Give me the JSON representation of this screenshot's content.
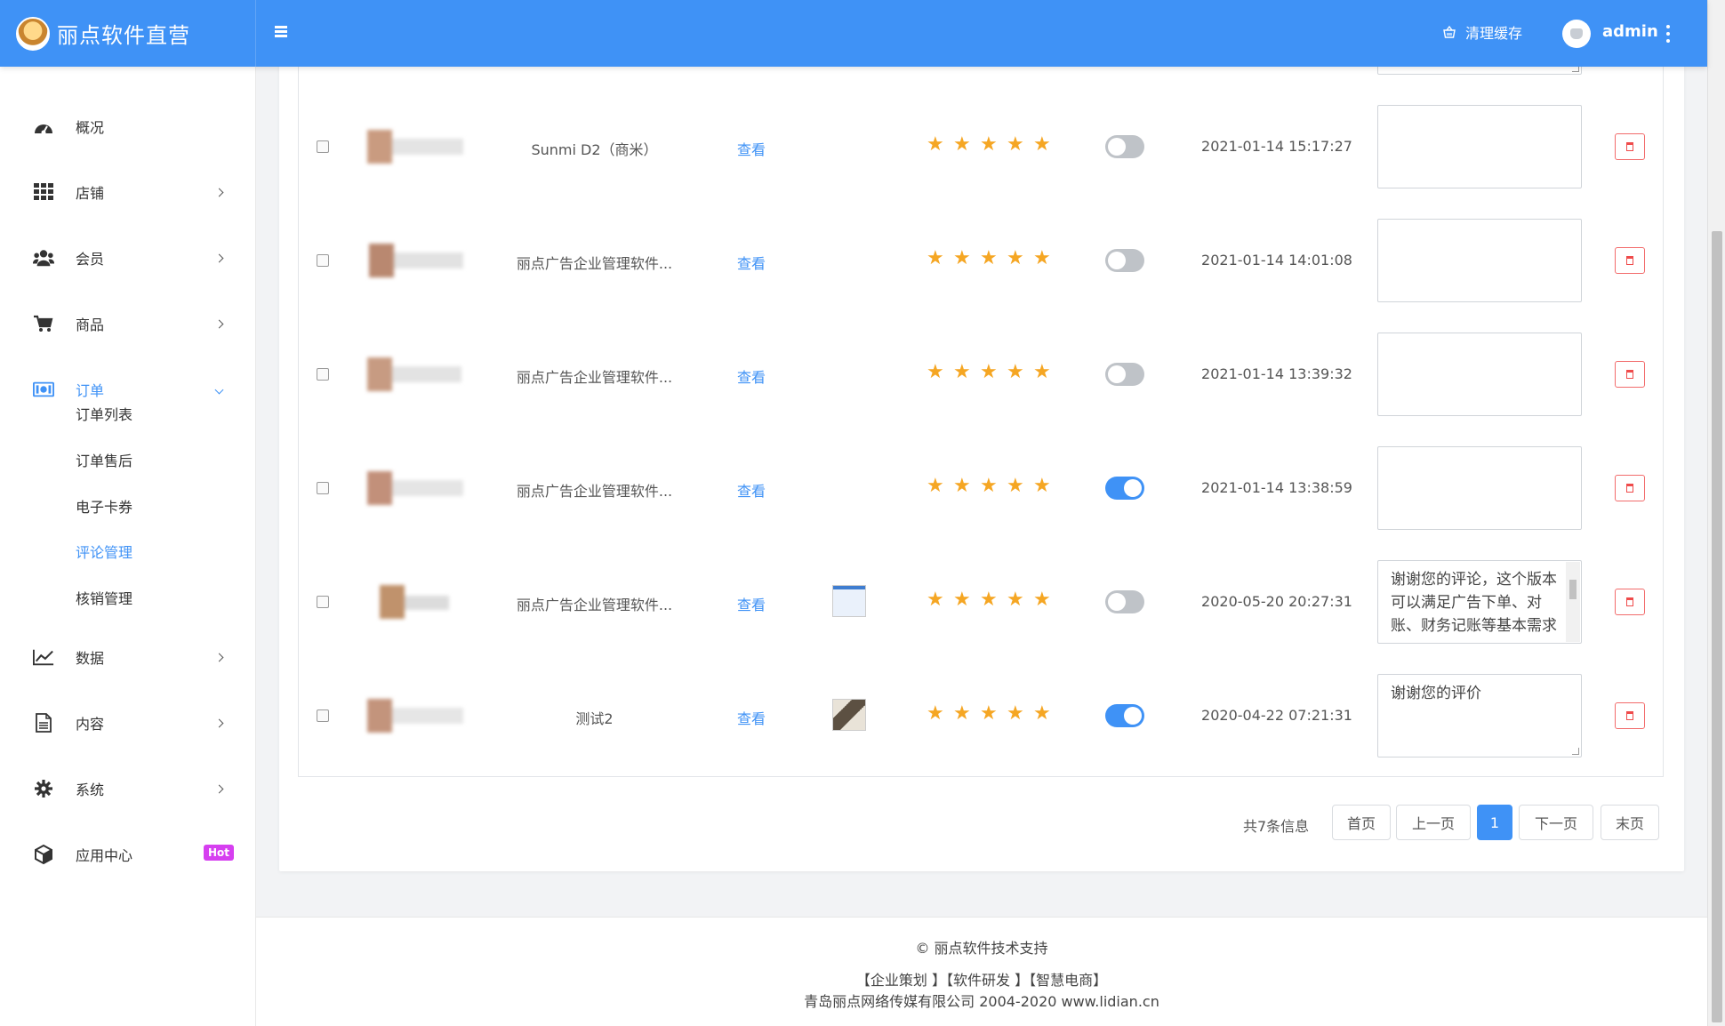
{
  "app": {
    "title": "丽点软件直营",
    "clear_cache": "清理缓存",
    "username": "admin"
  },
  "sidebar": {
    "items": [
      {
        "label": "概况",
        "icon": "dashboard-icon"
      },
      {
        "label": "店铺",
        "icon": "grid-icon"
      },
      {
        "label": "会员",
        "icon": "users-icon"
      },
      {
        "label": "商品",
        "icon": "cart-icon"
      },
      {
        "label": "订单",
        "icon": "money-icon"
      },
      {
        "label": "数据",
        "icon": "chart-line-icon"
      },
      {
        "label": "内容",
        "icon": "document-icon"
      },
      {
        "label": "系统",
        "icon": "gear-icon"
      },
      {
        "label": "应用中心",
        "icon": "cube-icon"
      }
    ],
    "order_sub": [
      "订单列表",
      "订单售后",
      "电子卡券",
      "评论管理",
      "核销管理"
    ],
    "hot": "Hot"
  },
  "reviews": [
    {
      "product": "Sunmi D2（商米）",
      "view": "查看",
      "stars": 5,
      "enabled": false,
      "date": "2021-01-14 15:17:27",
      "reply": ""
    },
    {
      "product": "丽点广告企业管理软件...",
      "view": "查看",
      "stars": 5,
      "enabled": false,
      "date": "2021-01-14 14:01:08",
      "reply": ""
    },
    {
      "product": "丽点广告企业管理软件...",
      "view": "查看",
      "stars": 5,
      "enabled": false,
      "date": "2021-01-14 13:39:32",
      "reply": ""
    },
    {
      "product": "丽点广告企业管理软件...",
      "view": "查看",
      "stars": 5,
      "enabled": true,
      "date": "2021-01-14 13:38:59",
      "reply": ""
    },
    {
      "product": "丽点广告企业管理软件...",
      "view": "查看",
      "stars": 5,
      "enabled": false,
      "date": "2020-05-20 20:27:31",
      "reply": "谢谢您的评论，这个版本可以满足广告下单、对账、财务记账等基本需求"
    },
    {
      "product": "测试2",
      "view": "查看",
      "stars": 5,
      "enabled": true,
      "date": "2020-04-22 07:21:31",
      "reply": "谢谢您的评价"
    }
  ],
  "pagination": {
    "info": "共7条信息",
    "first": "首页",
    "prev": "上一页",
    "current": "1",
    "next": "下一页",
    "last": "末页"
  },
  "footer": {
    "support": "© 丽点软件技术支持",
    "links": "【企业策划 】【软件研发 】【智慧电商】",
    "copyright": "青岛丽点网络传媒有限公司 2004-2020 www.lidian.cn"
  },
  "colors": {
    "primary": "#3f92f6",
    "star": "#f5a623",
    "danger": "#ef4b4b",
    "hot": "#d63ff0"
  }
}
